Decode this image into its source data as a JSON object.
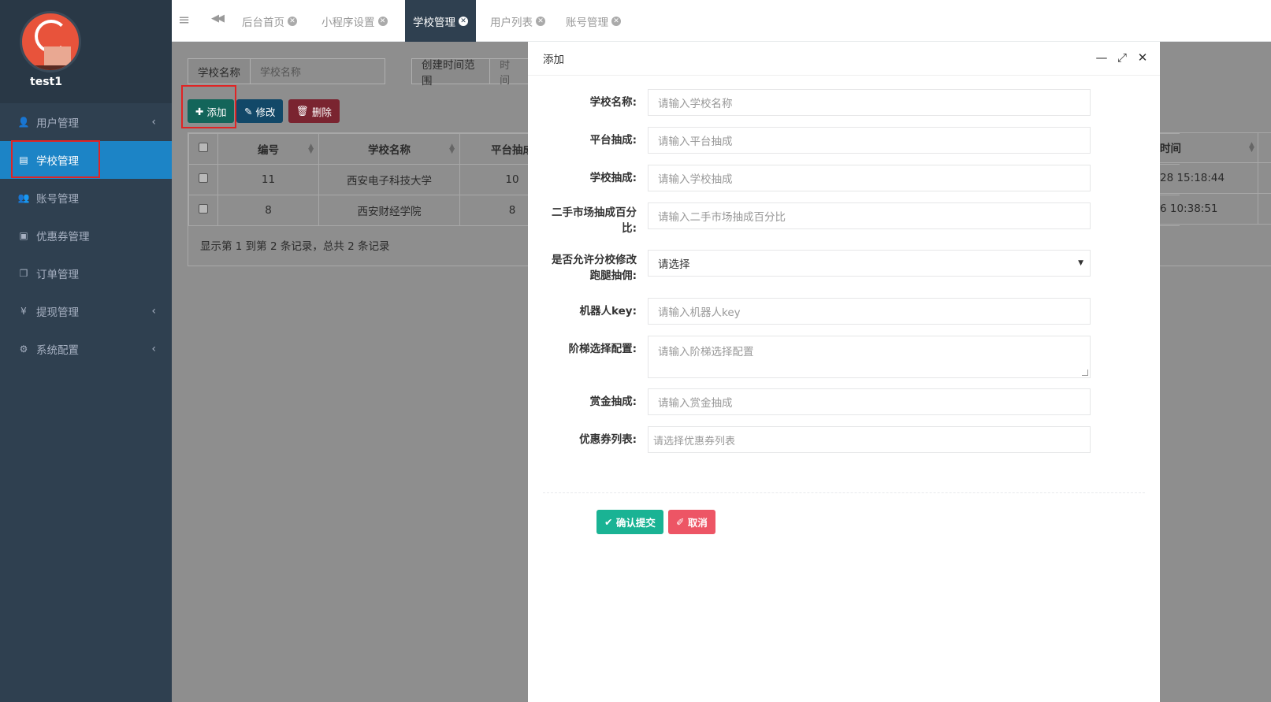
{
  "user": {
    "name": "test1"
  },
  "sidebar": {
    "items": [
      {
        "label": "用户管理",
        "icon": "user-icon",
        "glyph": "👤",
        "has_arrow": true
      },
      {
        "label": "学校管理",
        "icon": "building-icon",
        "glyph": "▤",
        "has_arrow": false,
        "active": true
      },
      {
        "label": "账号管理",
        "icon": "users-icon",
        "glyph": "👥",
        "has_arrow": false
      },
      {
        "label": "优惠券管理",
        "icon": "coupon-icon",
        "glyph": "▣",
        "has_arrow": false
      },
      {
        "label": "订单管理",
        "icon": "copy-icon",
        "glyph": "❐",
        "has_arrow": false
      },
      {
        "label": "提现管理",
        "icon": "yen-icon",
        "glyph": "¥",
        "has_arrow": true
      },
      {
        "label": "系统配置",
        "icon": "gear-icon",
        "glyph": "⚙",
        "has_arrow": true
      }
    ]
  },
  "tabs": [
    {
      "label": "后台首页"
    },
    {
      "label": "小程序设置"
    },
    {
      "label": "学校管理",
      "active": true
    },
    {
      "label": "用户列表"
    },
    {
      "label": "账号管理"
    }
  ],
  "search": {
    "school_name_label": "学校名称",
    "school_name_placeholder": "学校名称",
    "time_range_label": "创建时间范围",
    "time_placeholder": "时间"
  },
  "toolbar": {
    "add": "添加",
    "edit": "修改",
    "delete": "删除"
  },
  "table": {
    "headers": [
      "编号",
      "学校名称",
      "平台抽成",
      "时间"
    ],
    "rows": [
      {
        "id": "11",
        "name": "西安电子科技大学",
        "platform": "10",
        "time": "28 15:18:44"
      },
      {
        "id": "8",
        "name": "西安财经学院",
        "platform": "8",
        "time": "6 10:38:51"
      }
    ],
    "footer": "显示第 1 到第 2 条记录，总共 2 条记录"
  },
  "modal": {
    "title": "添加",
    "fields": [
      {
        "label": "学校名称:",
        "placeholder": "请输入学校名称"
      },
      {
        "label": "平台抽成:",
        "placeholder": "请输入平台抽成"
      },
      {
        "label": "学校抽成:",
        "placeholder": "请输入学校抽成"
      },
      {
        "label": "二手市场抽成百分比:",
        "placeholder": "请输入二手市场抽成百分比"
      },
      {
        "label": "是否允许分校修改跑腿抽佣:",
        "value": "请选择"
      },
      {
        "label": "机器人key:",
        "placeholder": "请输入机器人key"
      },
      {
        "label": "阶梯选择配置:",
        "placeholder": "请输入阶梯选择配置"
      },
      {
        "label": "赏金抽成:",
        "placeholder": "请输入赏金抽成"
      },
      {
        "label": "优惠券列表:",
        "placeholder": "请选择优惠券列表"
      }
    ],
    "submit": "确认提交",
    "cancel": "取消"
  }
}
